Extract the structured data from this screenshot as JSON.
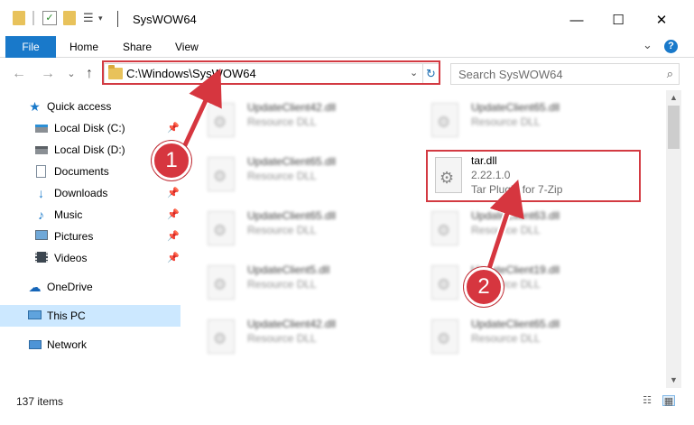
{
  "window": {
    "title": "SysWOW64",
    "minimize": "—",
    "maximize": "☐",
    "close": "✕"
  },
  "ribbon": {
    "tabs": [
      "File",
      "Home",
      "Share",
      "View"
    ],
    "collapse_glyph": "⌄",
    "help_glyph": "?"
  },
  "address": {
    "path": "C:\\Windows\\SysWOW64",
    "dropdown_glyph": "⌄",
    "refresh_glyph": "↻"
  },
  "search": {
    "placeholder": "Search SysWOW64",
    "icon": "search-icon"
  },
  "nav": {
    "back": "←",
    "forward": "→",
    "recent": "⌄",
    "up": "↑"
  },
  "sidebar": {
    "quick_access": "Quick access",
    "items": [
      {
        "label": "Local Disk (C:)",
        "icon": "drive-icon",
        "pinned": true
      },
      {
        "label": "Local Disk (D:)",
        "icon": "drive-icon",
        "pinned": false
      },
      {
        "label": "Documents",
        "icon": "documents-icon",
        "pinned": true
      },
      {
        "label": "Downloads",
        "icon": "downloads-icon",
        "pinned": true
      },
      {
        "label": "Music",
        "icon": "music-icon",
        "pinned": true
      },
      {
        "label": "Pictures",
        "icon": "pictures-icon",
        "pinned": true
      },
      {
        "label": "Videos",
        "icon": "videos-icon",
        "pinned": true
      }
    ],
    "onedrive": "OneDrive",
    "this_pc": "This PC",
    "network": "Network"
  },
  "files": {
    "left_column": [
      {
        "name": "UpdateClient42.dll",
        "type": "Resource DLL"
      },
      {
        "name": "UpdateClient65.dll",
        "type": "Resource DLL"
      },
      {
        "name": "UpdateClient65.dll",
        "type": "Resource DLL"
      },
      {
        "name": "UpdateClient5.dll",
        "type": "Resource DLL"
      },
      {
        "name": "UpdateClient42.dll",
        "type": "Resource DLL"
      }
    ],
    "right_column": [
      {
        "name": "UpdateClient65.dll",
        "type": "Resource DLL"
      },
      {
        "name": "UpdateClient63.dll",
        "type": "Resource DLL"
      },
      {
        "name": "UpdateClient19.dll",
        "type": "Resource DLL"
      },
      {
        "name": "UpdateClient65.dll",
        "type": "Resource DLL"
      }
    ],
    "highlighted": {
      "name": "tar.dll",
      "version": "2.22.1.0",
      "description": "Tar Plugin for 7-Zip"
    }
  },
  "status": {
    "item_count": "137 items"
  },
  "callouts": {
    "one": "1",
    "two": "2",
    "color": "#d6363f"
  },
  "colors": {
    "accent": "#1979ca",
    "selection": "#cce8ff",
    "highlight": "#d33a42"
  }
}
